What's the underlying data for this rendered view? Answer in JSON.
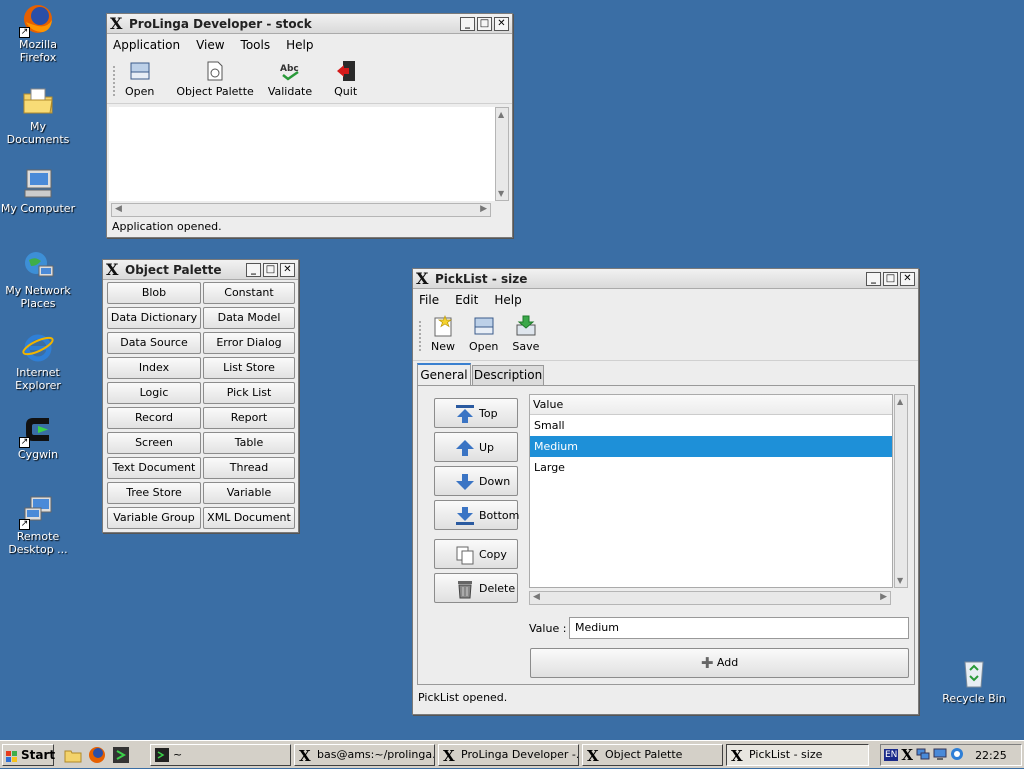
{
  "desktop": {
    "icons": [
      {
        "label": "Mozilla Firefox",
        "icon": "firefox-icon"
      },
      {
        "label": "My Documents",
        "icon": "folder-documents-icon"
      },
      {
        "label": "My Computer",
        "icon": "computer-icon"
      },
      {
        "label": "My Network Places",
        "icon": "network-icon"
      },
      {
        "label": "Internet Explorer",
        "icon": "internet-explorer-icon"
      },
      {
        "label": "Cygwin",
        "icon": "cygwin-icon"
      },
      {
        "label": "Remote Desktop ...",
        "icon": "remote-desktop-icon"
      },
      {
        "label": "Recycle Bin",
        "icon": "recycle-bin-icon"
      }
    ]
  },
  "main_window": {
    "title": "ProLinga Developer - stock",
    "menu": [
      "Application",
      "View",
      "Tools",
      "Help"
    ],
    "toolbar": [
      "Open",
      "Object Palette",
      "Validate",
      "Quit"
    ],
    "status": "Application opened."
  },
  "palette_window": {
    "title": "Object Palette",
    "buttons": [
      "Blob",
      "Constant",
      "Data Dictionary",
      "Data Model",
      "Data Source",
      "Error Dialog",
      "Index",
      "List Store",
      "Logic",
      "Pick List",
      "Record",
      "Report",
      "Screen",
      "Table",
      "Text Document",
      "Thread",
      "Tree Store",
      "Variable",
      "Variable Group",
      "XML Document"
    ]
  },
  "picklist_window": {
    "title": "PickList - size",
    "menu": [
      "File",
      "Edit",
      "Help"
    ],
    "toolbar": [
      "New",
      "Open",
      "Save"
    ],
    "tabs": [
      "General",
      "Description"
    ],
    "active_tab": "General",
    "side_buttons": [
      "Top",
      "Up",
      "Down",
      "Bottom",
      "Copy",
      "Delete"
    ],
    "list_header": "Value",
    "list_items": [
      "Small",
      "Medium",
      "Large"
    ],
    "selected_item": "Medium",
    "value_label": "Value :",
    "value_input": "Medium",
    "add_label": "Add",
    "status": "PickList opened."
  },
  "taskbar": {
    "start_label": "Start",
    "tasks": [
      "~",
      "bas@ams:~/prolinga...",
      "ProLinga Developer -...",
      "Object Palette",
      "PickList - size"
    ],
    "tray_lang": "EN",
    "clock": "22:25"
  },
  "colors": {
    "desktop": "#3a6ea5",
    "selection": "#1e90d8"
  }
}
